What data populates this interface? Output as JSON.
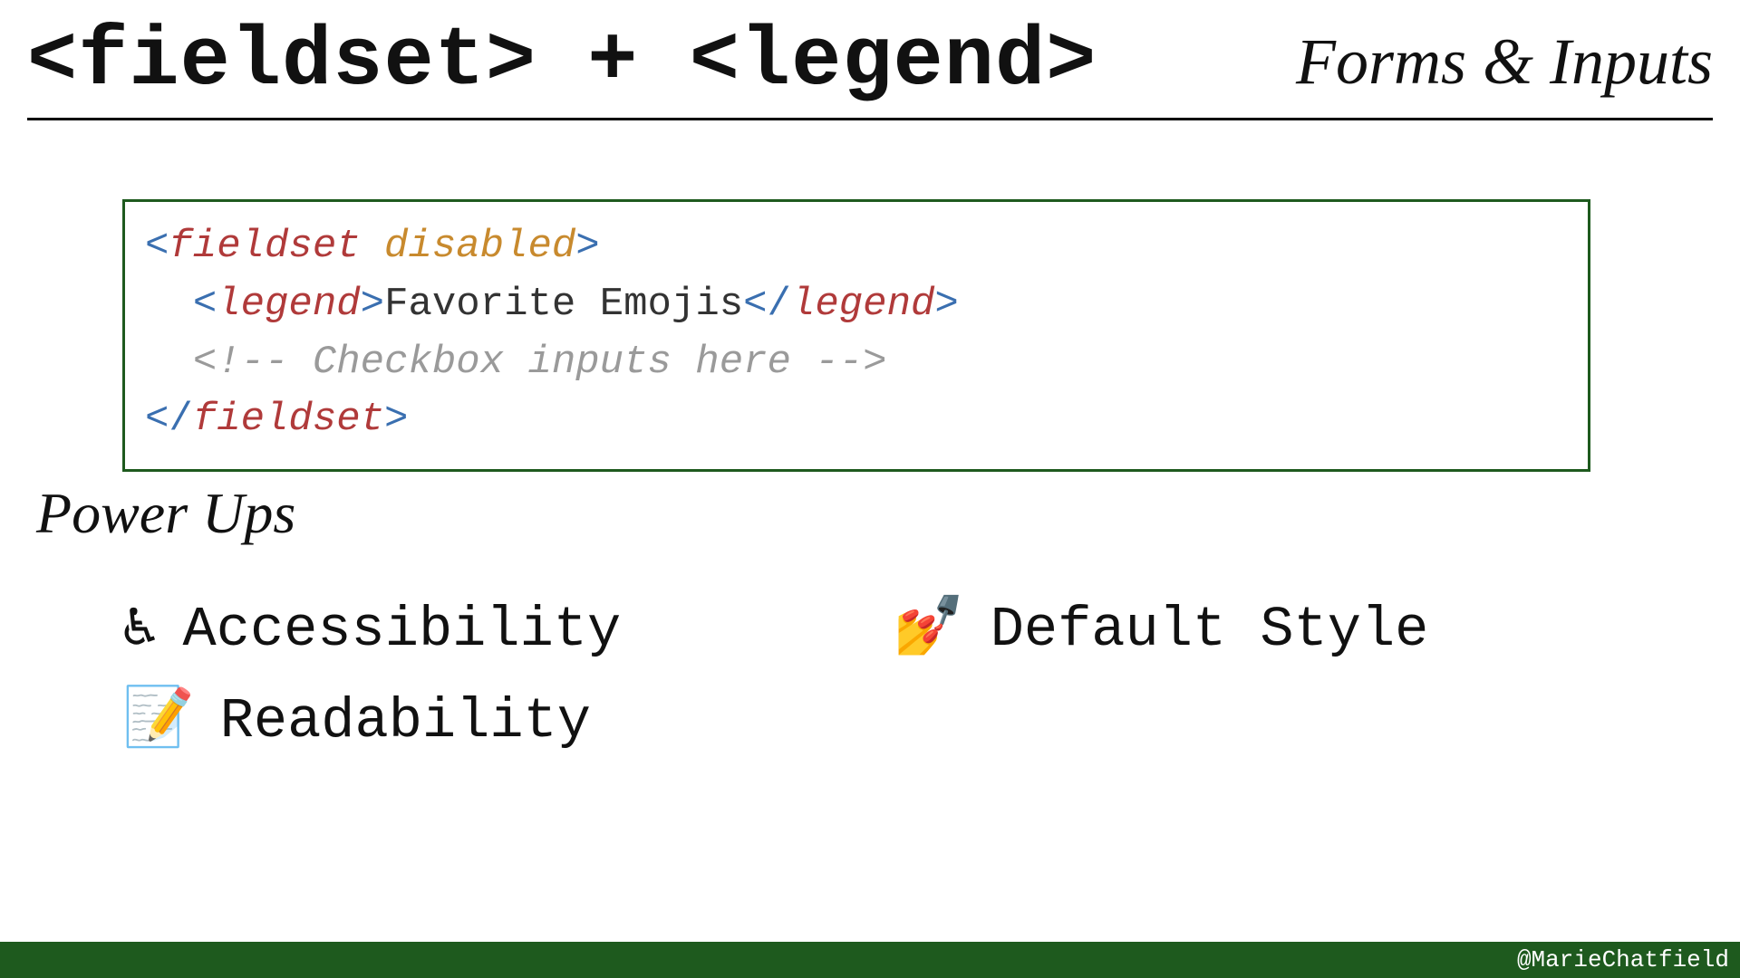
{
  "header": {
    "title": "<fieldset> + <legend>",
    "category": "Forms & Inputs"
  },
  "code": {
    "line1_open_bracket": "<",
    "line1_tag": "fieldset",
    "line1_space": " ",
    "line1_attr": "disabled",
    "line1_close_bracket": ">",
    "line2_indent": "  ",
    "line2_open": "<",
    "line2_tag": "legend",
    "line2_gt": ">",
    "line2_text": "Favorite Emojis",
    "line2_close_open": "</",
    "line2_close_tag": "legend",
    "line2_close_gt": ">",
    "line3_indent": "  ",
    "line3_comment": "<!-- Checkbox inputs here -->",
    "line4_open": "</",
    "line4_tag": "fieldset",
    "line4_gt": ">"
  },
  "section": {
    "powerups_heading": "Power Ups"
  },
  "powerups": [
    {
      "emoji": "♿",
      "label": "Accessibility"
    },
    {
      "emoji": "💅",
      "label": "Default Style"
    },
    {
      "emoji": "📝",
      "label": "Readability"
    }
  ],
  "footer": {
    "handle": "@MarieChatfield"
  }
}
